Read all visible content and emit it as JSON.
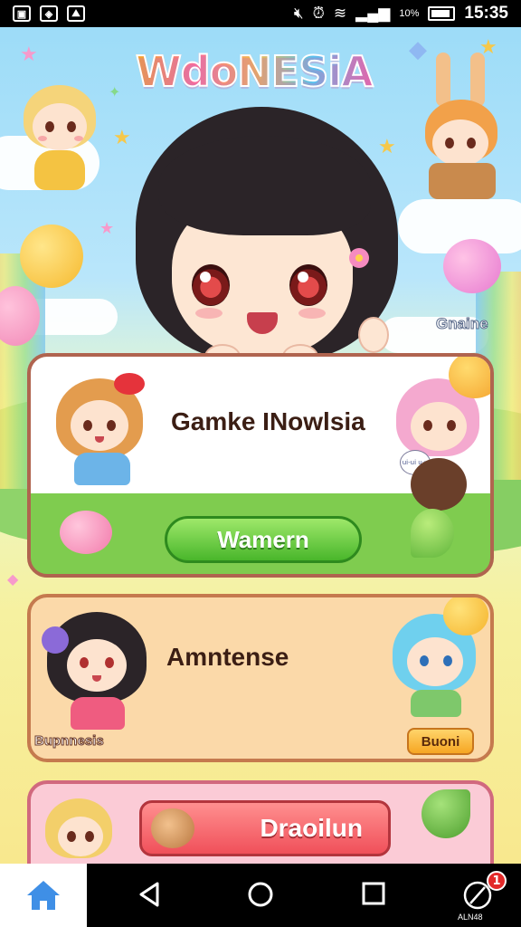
{
  "status_bar": {
    "time": "15:35",
    "battery_text": "10%",
    "left_icons": [
      "sim-card-icon",
      "notification-icon",
      "gallery-icon"
    ],
    "right_icons": [
      "mute-icon",
      "alarm-icon",
      "wifi-icon",
      "signal-icon",
      "battery-icon"
    ]
  },
  "header": {
    "logo_text": "WdoNESiA"
  },
  "scene": {
    "game_label": "Gnaine"
  },
  "cards": {
    "card1": {
      "title": "Gamke INowlsia",
      "button_label": "Wamern",
      "speech_text": "ui-ui\nu-y"
    },
    "card2": {
      "title": "Amntense",
      "sub_label": "Bupnnesis",
      "pill_label": "Buoni"
    },
    "card3": {
      "button_label": "Draoilun"
    }
  },
  "navbar": {
    "items": [
      "home-icon",
      "back-icon",
      "home-circle-icon",
      "recents-icon",
      "compass-icon"
    ],
    "badge_count": "1",
    "last_label": "ALN48"
  },
  "colors": {
    "card1_border": "#b0644f",
    "card2_bg": "#fbd9a9",
    "card3_bg": "#fbcbd6",
    "green_button": "#49b62b",
    "pink_button": "#f0505a",
    "nav_home_tab": "#ffffff"
  }
}
